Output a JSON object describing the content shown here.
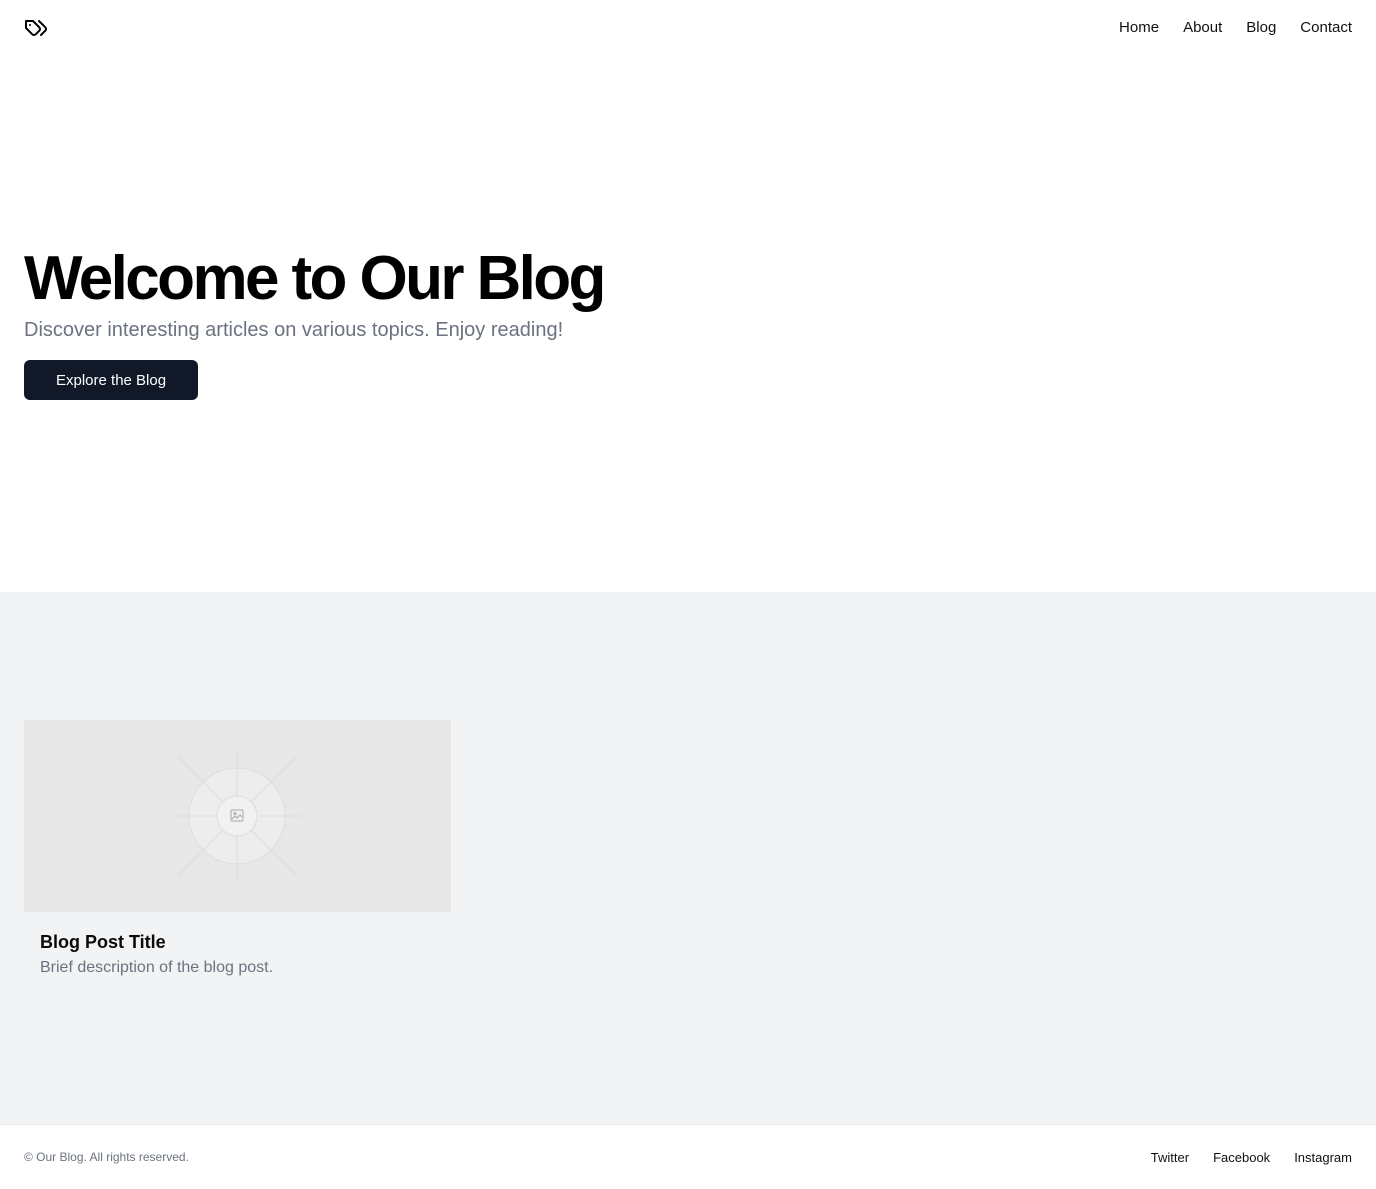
{
  "header": {
    "logo_icon": "tags-icon",
    "nav": [
      {
        "label": "Home"
      },
      {
        "label": "About"
      },
      {
        "label": "Blog"
      },
      {
        "label": "Contact"
      }
    ]
  },
  "hero": {
    "title": "Welcome to Our Blog",
    "subtitle": "Discover interesting articles on various topics. Enjoy reading!",
    "cta_label": "Explore the Blog"
  },
  "posts": [
    {
      "image_icon": "image-placeholder-icon",
      "title": "Blog Post Title",
      "description": "Brief description of the blog post."
    }
  ],
  "footer": {
    "copyright": "© Our Blog. All rights reserved.",
    "links": [
      {
        "label": "Twitter"
      },
      {
        "label": "Facebook"
      },
      {
        "label": "Instagram"
      }
    ]
  },
  "colors": {
    "primary_button_bg": "#111827",
    "muted_text": "#6b7280",
    "section_bg": "#f2f3f5",
    "placeholder_bg": "#e7e7e7"
  }
}
